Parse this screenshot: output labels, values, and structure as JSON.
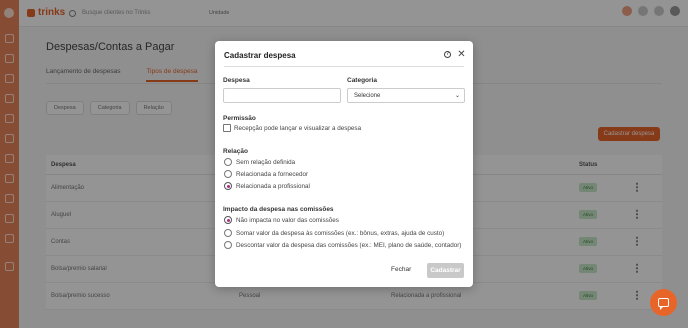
{
  "topbar": {
    "brand": "trinks",
    "search_placeholder": "Busque clientes no Trinks",
    "unit_selector": "Unidade"
  },
  "page": {
    "title": "Despesas/Contas a Pagar",
    "tabs": [
      "Lançamento de despesas",
      "Tipos de despesa"
    ],
    "filters": [
      "Despesa",
      "Categoria",
      "Relação"
    ],
    "new_button": "Cadastrar despesa"
  },
  "table": {
    "headers": [
      "Despesa",
      "Status"
    ],
    "rows": [
      {
        "name": "Alimentação",
        "category": "",
        "relation": "",
        "status": "Ativo"
      },
      {
        "name": "Aluguel",
        "category": "",
        "relation": "",
        "status": "Ativo"
      },
      {
        "name": "Contas",
        "category": "",
        "relation": "",
        "status": "Ativo"
      },
      {
        "name": "Bolsa/premio salarial",
        "category": "",
        "relation": "",
        "status": "Ativo"
      },
      {
        "name": "Bolsa/premio sucesso",
        "category": "Pessoal",
        "relation": "Relacionada a profissional",
        "status": "Ativo"
      }
    ]
  },
  "modal": {
    "title": "Cadastrar despesa",
    "despesa_label": "Despesa",
    "despesa_value": "",
    "categoria_label": "Categoria",
    "categoria_value": "Selecione",
    "permissao_label": "Permissão",
    "permissao_checkbox": "Recepção pode lançar e visualizar a despesa",
    "relacao_label": "Relação",
    "relacao_options": [
      {
        "label": "Sem relação definida",
        "selected": false
      },
      {
        "label": "Relacionada a fornecedor",
        "selected": false
      },
      {
        "label": "Relacionada a profissional",
        "selected": true
      }
    ],
    "impacto_label": "Impacto da despesa nas comissões",
    "impacto_options": [
      {
        "label": "Não impacta no valor das comissões",
        "selected": true
      },
      {
        "label": "Somar valor da despesa às comissões (ex.: bônus, extras, ajuda de custo)",
        "selected": false
      },
      {
        "label": "Descontar valor da despesa das comissões (ex.: MEI, plano de saúde, contador)",
        "selected": false
      }
    ],
    "close_button": "Fechar",
    "save_button": "Cadastrar"
  },
  "colors": {
    "accent": "#e8652a",
    "radio_selected": "#b02a8a",
    "save_disabled": "#c9c9c9"
  }
}
